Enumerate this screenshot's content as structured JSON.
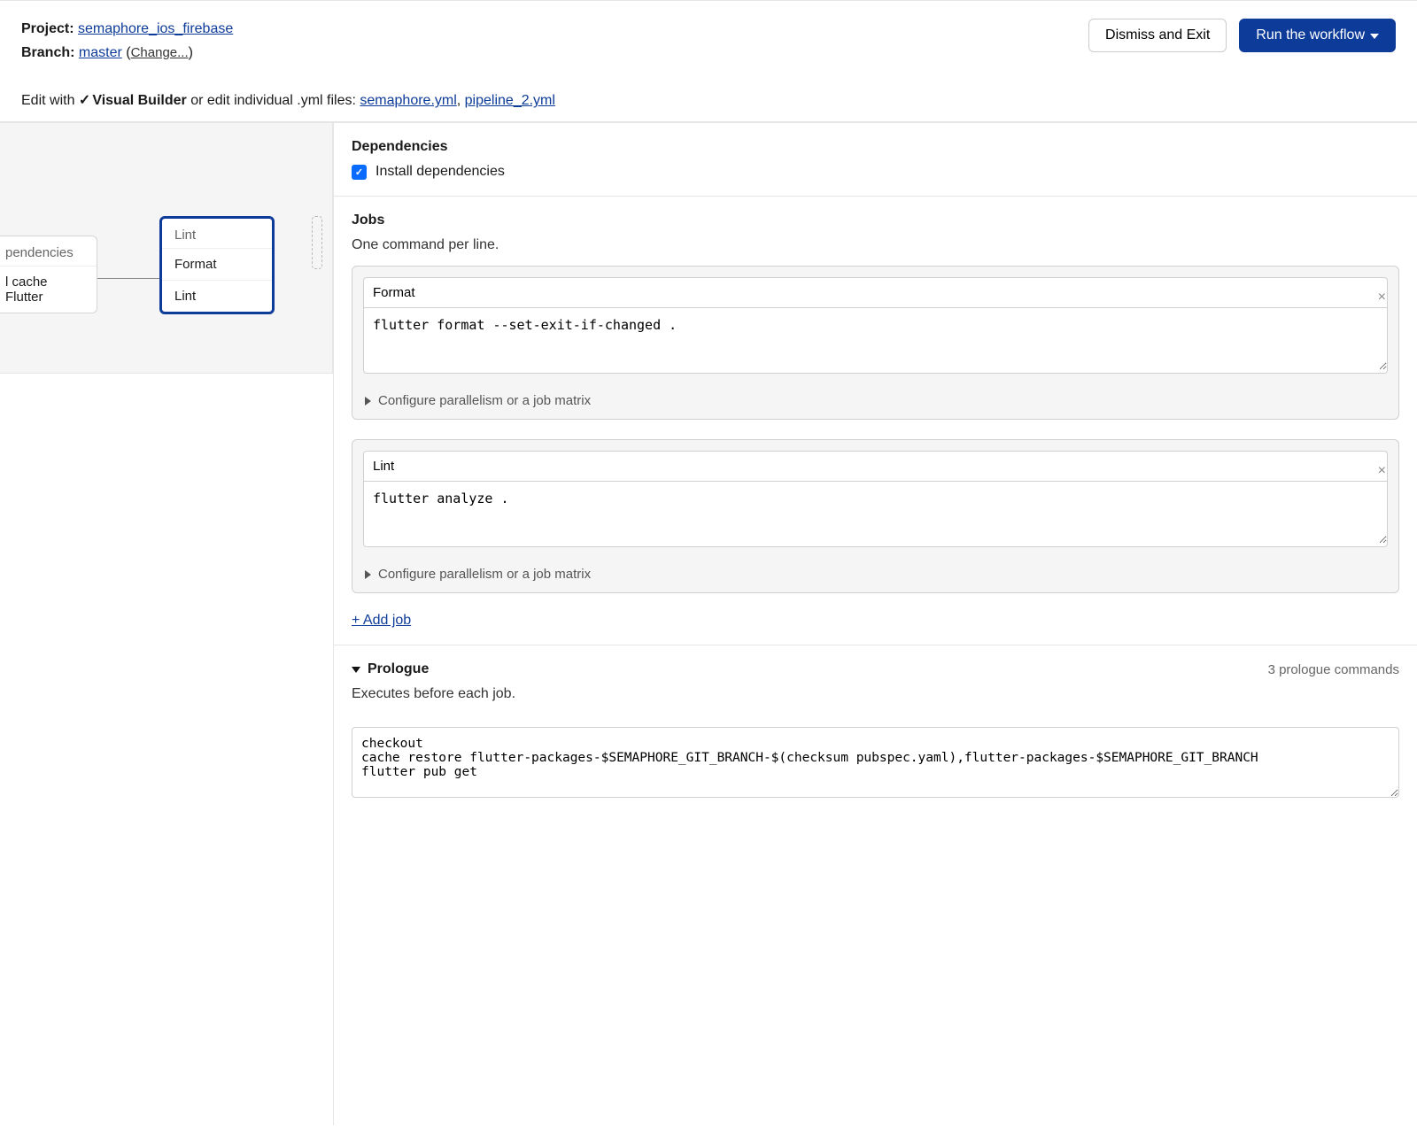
{
  "header": {
    "project_label": "Project:",
    "project_name": "semaphore_ios_firebase",
    "branch_label": "Branch:",
    "branch_name": "master",
    "change_text": "Change...",
    "dismiss_button": "Dismiss and Exit",
    "run_button": "Run the workflow"
  },
  "editbar": {
    "prefix": "Edit with",
    "visual_builder": "Visual Builder",
    "mid": "or edit individual .yml files:",
    "file1": "semaphore.yml",
    "file2": "pipeline_2.yml"
  },
  "canvas": {
    "dep_card_header": "pendencies",
    "dep_card_item": "l cache Flutter",
    "lint_card_header": "Lint",
    "lint_card_items": [
      "Format",
      "Lint"
    ]
  },
  "panel": {
    "deps_title": "Dependencies",
    "deps_checkbox_label": "Install dependencies",
    "jobs_title": "Jobs",
    "jobs_sub": "One command per line.",
    "jobs": [
      {
        "name": "Format",
        "commands": "flutter format --set-exit-if-changed ."
      },
      {
        "name": "Lint",
        "commands": "flutter analyze ."
      }
    ],
    "configure_parallelism": "Configure parallelism or a job matrix",
    "add_job": "+ Add job",
    "prologue_title": "Prologue",
    "prologue_count": "3 prologue commands",
    "prologue_sub": "Executes before each job.",
    "prologue_commands": "checkout\ncache restore flutter-packages-$SEMAPHORE_GIT_BRANCH-$(checksum pubspec.yaml),flutter-packages-$SEMAPHORE_GIT_BRANCH\nflutter pub get"
  }
}
